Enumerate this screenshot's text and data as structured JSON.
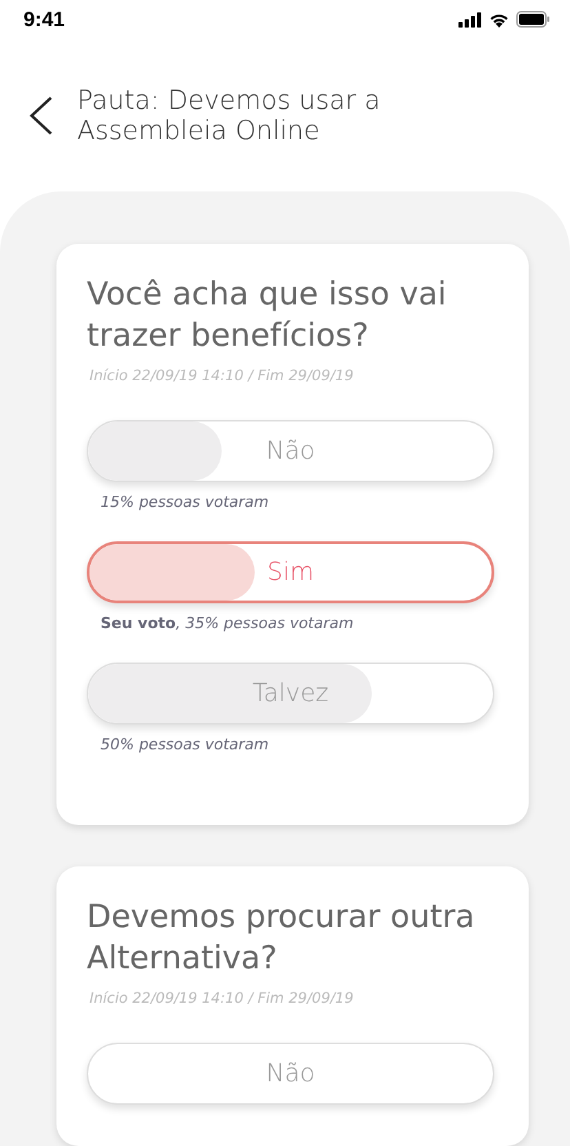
{
  "status_bar": {
    "time": "9:41"
  },
  "header": {
    "title": "Pauta: Devemos usar a Assembleia Online"
  },
  "questions": [
    {
      "title": "Você acha que isso vai trazer benefícios?",
      "dates": "Início 22/09/19 14:10 / Fim 29/09/19",
      "options": [
        {
          "label": "Não",
          "selected": false,
          "level": 0.33,
          "note": "15% pessoas votaram"
        },
        {
          "label": "Sim",
          "selected": true,
          "level": 0.41,
          "note": "**Seu voto**, 35% pessoas votaram"
        },
        {
          "label": "Talvez",
          "selected": false,
          "level": 0.7,
          "note": "50% pessoas votaram"
        }
      ]
    },
    {
      "title": "Devemos procurar outra Alternativa?",
      "dates": "Início 22/09/19 14:10 / Fim 29/09/19",
      "options": [
        {
          "label": "Não",
          "selected": false
        }
      ]
    }
  ]
}
